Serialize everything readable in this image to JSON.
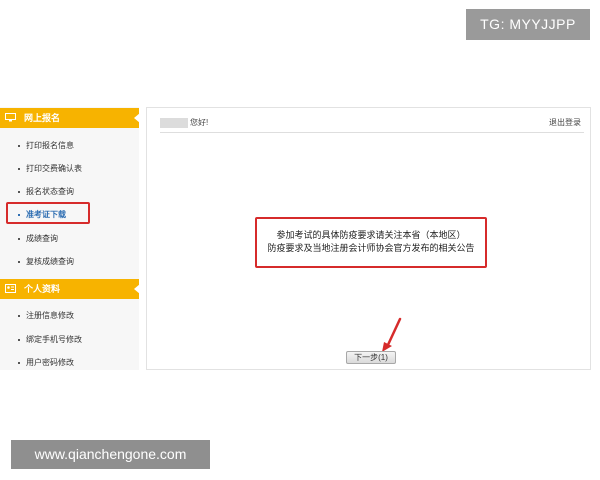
{
  "watermark": {
    "tg": "TG: MYYJJPP",
    "site": "www.qianchengone.com"
  },
  "sidebar": {
    "sections": [
      {
        "title": "网上报名",
        "icon": "monitor-icon",
        "items": [
          {
            "label": "打印报名信息"
          },
          {
            "label": "打印交费确认表"
          },
          {
            "label": "报名状态查询"
          },
          {
            "label": "准考证下载",
            "active": true
          },
          {
            "label": "成绩查询"
          },
          {
            "label": "复核成绩查询"
          }
        ]
      },
      {
        "title": "个人资料",
        "icon": "id-card-icon",
        "items": [
          {
            "label": "注册信息修改"
          },
          {
            "label": "绑定手机号修改"
          },
          {
            "label": "用户密码修改"
          }
        ]
      }
    ],
    "accent_color": "#f7b300",
    "active_color": "#2f6fb3"
  },
  "header": {
    "greeting": "您好!",
    "logout": "退出登录"
  },
  "notice": {
    "line1": "参加考试的具体防疫要求请关注本省（本地区）",
    "line2": "防疫要求及当地注册会计师协会官方发布的相关公告"
  },
  "next_button": {
    "label": "下一步(1)"
  },
  "highlight_color": "#d62b2b"
}
